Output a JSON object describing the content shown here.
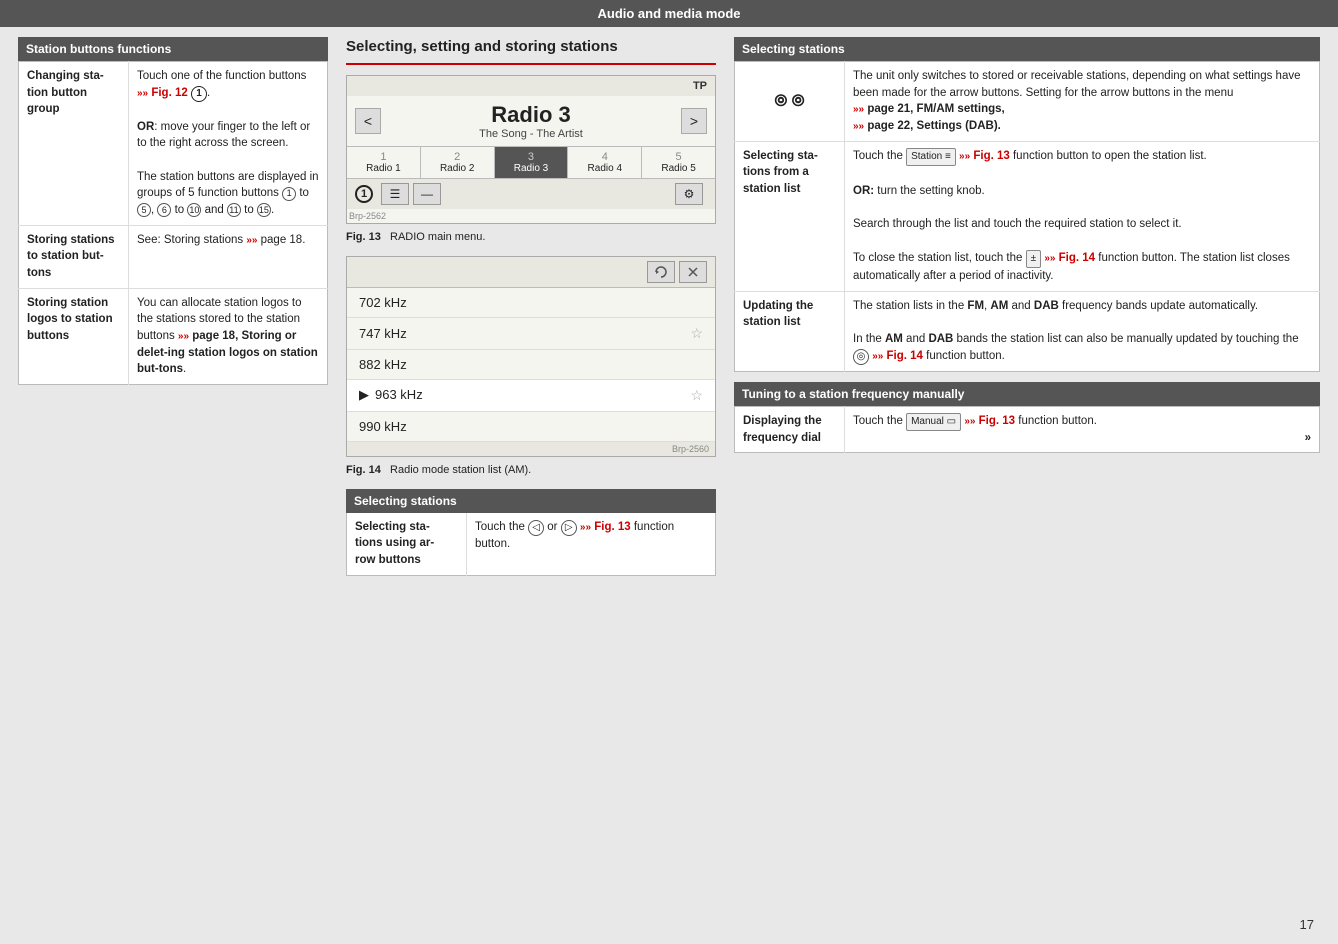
{
  "header": {
    "title": "Audio and media mode"
  },
  "left_section": {
    "header": "Station buttons functions",
    "rows": [
      {
        "label": "Changing station button group",
        "content_parts": [
          "Touch one of the function buttons",
          " Fig. 12 ",
          ".",
          "OR: move your finger to the left or to the right across the screen.",
          "The station buttons are displayed in groups of 5 function buttons (",
          "1",
          ") to (",
          "5",
          "), (",
          "6",
          ") to (",
          "10",
          ") and (",
          "11",
          ") to (",
          "15",
          ")."
        ],
        "content": "Touch one of the function buttons »» Fig. 12 ①.\nOR: move your finger to the left or to the right across the screen.\nThe station buttons are displayed in groups of 5 function buttons ① to ⑤, ⑥ to ⑩ and ⑪ to ⑮."
      },
      {
        "label": "Storing stations to station buttons",
        "content": "See: Storing stations »» page 18."
      },
      {
        "label": "Storing station logos to station buttons",
        "content": "You can allocate station logos to the stations stored to the station buttons»» page 18, Storing or deleting station logos on station buttons."
      }
    ]
  },
  "mid_section": {
    "title": "Selecting, setting and storing stations",
    "radio_display": {
      "tp_label": "TP",
      "station_name": "Radio 3",
      "song_info": "The Song - The Artist",
      "presets": [
        {
          "num": "1",
          "label": "Radio 1"
        },
        {
          "num": "2",
          "label": "Radio 2"
        },
        {
          "num": "3",
          "label": "Radio 3",
          "active": true
        },
        {
          "num": "4",
          "label": "Radio 4"
        },
        {
          "num": "5",
          "label": "Radio 5"
        }
      ],
      "brp": "Brp-2562"
    },
    "fig13_caption": "Fig. 13   RADIO main menu.",
    "station_list": {
      "entries": [
        {
          "freq": "702 kHz",
          "star": false,
          "playing": false
        },
        {
          "freq": "747 kHz",
          "star": true,
          "playing": false
        },
        {
          "freq": "882 kHz",
          "star": false,
          "playing": false
        },
        {
          "freq": "963 kHz",
          "star": true,
          "playing": true
        },
        {
          "freq": "990 kHz",
          "star": false,
          "playing": false
        }
      ],
      "brp": "Brp-2560"
    },
    "fig14_caption": "Fig. 14   Radio mode station list (AM).",
    "selecting_stations": {
      "header": "Selecting stations",
      "row_label": "Selecting stations using arrow buttons",
      "row_content": "Touch the ⓒ or ⓓ»» Fig. 13 function button."
    }
  },
  "right_section": {
    "selecting_header": "Selecting stations",
    "selecting_rows": [
      {
        "label": "",
        "content": "The unit only switches to stored or receivable stations, depending on what settings have been made for the arrow buttons. Setting for the arrow buttons in the menu »» page 21, FM/AM settings, »» page 22, Settings (DAB).",
        "icon": "⊙⊙"
      },
      {
        "label": "Selecting stations from a station list",
        "content_html": "Touch the <kbd>Station ≡</kbd> »» Fig. 13 function button to open the station list.<br><br><b>OR:</b> turn the setting knob.<br><br>Search through the list and touch the required station to select it.<br><br>To close the station list, touch the <kbd>±</kbd> »» Fig. 14 function button. The station list closes automatically after a period of inactivity.",
        "content": "Touch the Station »» Fig. 13 function button to open the station list.\nOR: turn the setting knob.\nSearch through the list and touch the required station to select it.\nTo close the station list, touch the ± »» Fig. 14 function button. The station list closes automatically after a period of inactivity."
      },
      {
        "label": "Updating the station list",
        "content": "The station lists in the FM, AM and DAB frequency bands update automatically.\nIn the AM and DAB bands the station list can also be manually updated by touching the ⊙ »» Fig. 14 function button.",
        "content_html": "The station lists in the <b>FM</b>, <b>AM</b> and <b>DAB</b> frequency bands update automatically.<br><br>In the <b>AM</b> and <b>DAB</b> bands the station list can also be manually updated by touching the <span style='border:1px solid #888;padding:1px 3px;font-size:10px;border-radius:50%;'>⊙</span>»» Fig. 14 function button."
      }
    ],
    "tuning_header": "Tuning to a station frequency manually",
    "tuning_rows": [
      {
        "label": "Displaying the frequency dial",
        "content": "Touch the Manual »» Fig. 13 function button."
      }
    ]
  },
  "page_number": "17"
}
